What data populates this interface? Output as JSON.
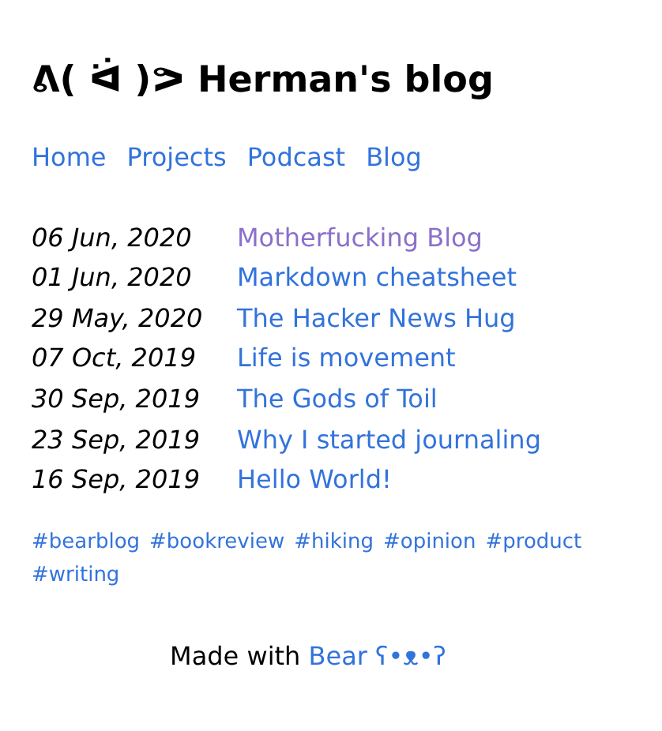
{
  "title": "ᕕ( ᐛ )ᕗ Herman's blog",
  "nav": [
    "Home",
    "Projects",
    "Podcast",
    "Blog"
  ],
  "posts": [
    {
      "date": "06 Jun, 2020",
      "title": "Motherfucking Blog",
      "visited": true
    },
    {
      "date": "01 Jun, 2020",
      "title": "Markdown cheatsheet",
      "visited": false
    },
    {
      "date": "29 May, 2020",
      "title": "The Hacker News Hug",
      "visited": false
    },
    {
      "date": "07 Oct, 2019",
      "title": "Life is movement",
      "visited": false
    },
    {
      "date": "30 Sep, 2019",
      "title": "The Gods of Toil",
      "visited": false
    },
    {
      "date": "23 Sep, 2019",
      "title": "Why I started journaling",
      "visited": false
    },
    {
      "date": "16 Sep, 2019",
      "title": "Hello World!",
      "visited": false
    }
  ],
  "tags": [
    "#bearblog",
    "#bookreview",
    "#hiking",
    "#opinion",
    "#product",
    "#writing"
  ],
  "footer": {
    "text": "Made with",
    "link": "Bear ʕ•ᴥ•ʔ"
  }
}
